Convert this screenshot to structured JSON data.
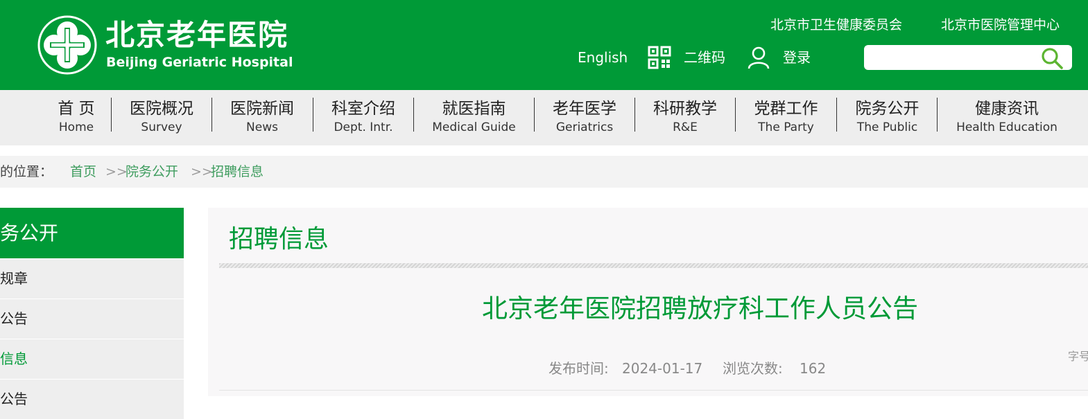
{
  "header": {
    "logo_cn": "北京老年医院",
    "logo_en": "Beijing Geriatric Hospital",
    "top_links": [
      "北京市卫生健康委员会",
      "北京市医院管理中心"
    ],
    "english_label": "English",
    "qr_label": "二维码",
    "login_label": "登录",
    "search_placeholder": "",
    "brand_color": "#009a37"
  },
  "nav": [
    {
      "cn": "首 页",
      "en": "Home"
    },
    {
      "cn": "医院概况",
      "en": "Survey"
    },
    {
      "cn": "医院新闻",
      "en": "News"
    },
    {
      "cn": "科室介绍",
      "en": "Dept. Intr."
    },
    {
      "cn": "就医指南",
      "en": "Medical Guide"
    },
    {
      "cn": "老年医学",
      "en": "Geriatrics"
    },
    {
      "cn": "科研教学",
      "en": "R&E"
    },
    {
      "cn": "党群工作",
      "en": "The Party"
    },
    {
      "cn": "院务公开",
      "en": "The Public"
    },
    {
      "cn": "健康资讯",
      "en": "Health Education"
    }
  ],
  "breadcrumb": {
    "label": "的位置：",
    "items": [
      "首页",
      "院务公开",
      "招聘信息"
    ],
    "separator": ">>"
  },
  "sidebar": {
    "title": "务公开",
    "items": [
      {
        "label": "规章",
        "active": false
      },
      {
        "label": "公告",
        "active": false
      },
      {
        "label": "信息",
        "active": true
      },
      {
        "label": "公告",
        "active": false
      }
    ]
  },
  "main": {
    "section_title": "招聘信息",
    "article_title": "北京老年医院招聘放疗科工作人员公告",
    "publish_label": "发布时间:",
    "publish_date": "2024-01-17",
    "views_label": "浏览次数:",
    "views_count": "162",
    "font_size_label": "字号"
  }
}
